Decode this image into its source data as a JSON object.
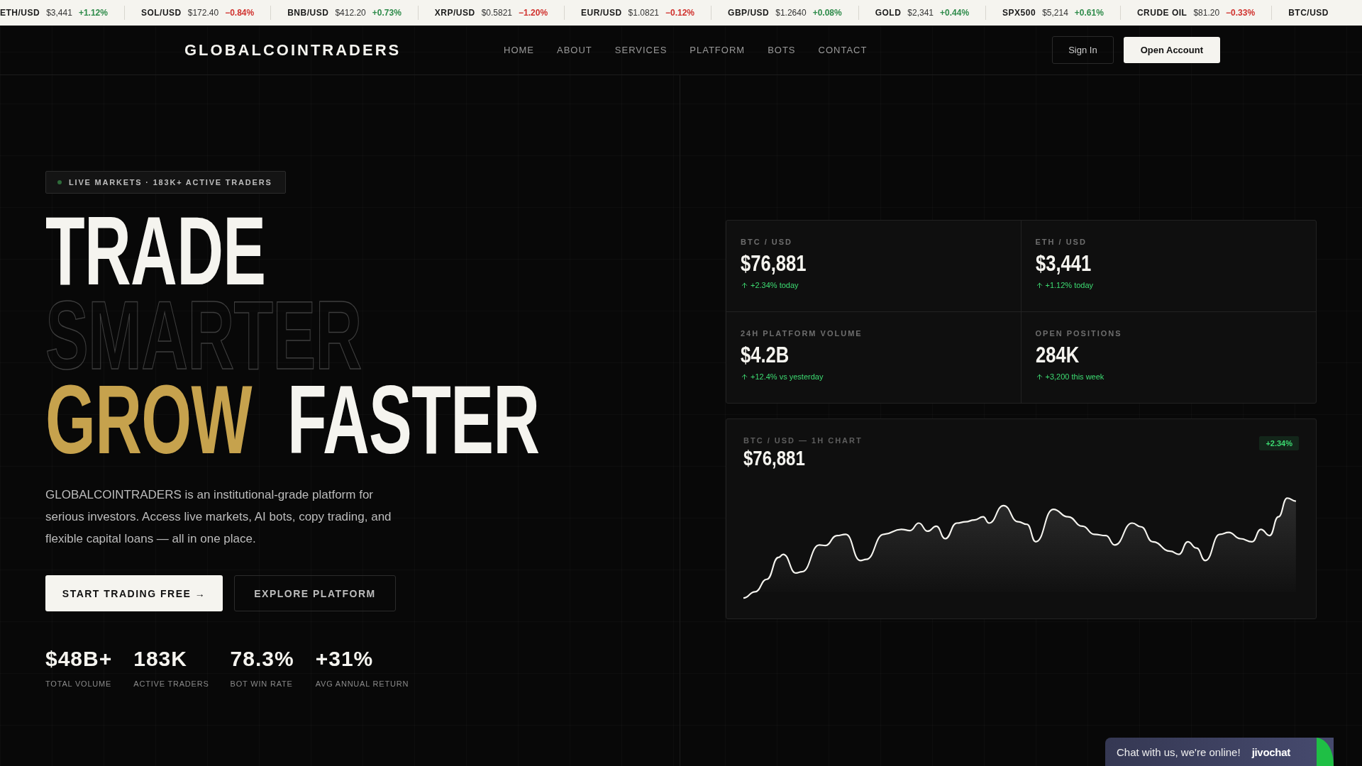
{
  "ticker": [
    {
      "symbol": "ETH/USD",
      "price": "$3,441",
      "change": "+1.12%",
      "color": "#2e8b4a"
    },
    {
      "symbol": "SOL/USD",
      "price": "$172.40",
      "change": "−0.84%",
      "color": "#d0312d"
    },
    {
      "symbol": "BNB/USD",
      "price": "$412.20",
      "change": "+0.73%",
      "color": "#2e8b4a"
    },
    {
      "symbol": "XRP/USD",
      "price": "$0.5821",
      "change": "−1.20%",
      "color": "#d0312d"
    },
    {
      "symbol": "EUR/USD",
      "price": "$1.0821",
      "change": "−0.12%",
      "color": "#d0312d"
    },
    {
      "symbol": "GBP/USD",
      "price": "$1.2640",
      "change": "+0.08%",
      "color": "#2e8b4a"
    },
    {
      "symbol": "GOLD",
      "price": "$2,341",
      "change": "+0.44%",
      "color": "#2e8b4a"
    },
    {
      "symbol": "SPX500",
      "price": "$5,214",
      "change": "+0.61%",
      "color": "#2e8b4a"
    },
    {
      "symbol": "CRUDE OIL",
      "price": "$81.20",
      "change": "−0.33%",
      "color": "#d0312d"
    },
    {
      "symbol": "BTC/USD"
    }
  ],
  "nav": {
    "logo": "GLOBALCOINTRADERS",
    "links": [
      {
        "label": "HOME"
      },
      {
        "label": "ABOUT"
      },
      {
        "label": "SERVICES"
      },
      {
        "label": "PLATFORM"
      },
      {
        "label": "BOTS"
      },
      {
        "label": "CONTACT"
      }
    ],
    "sign_in": "Sign In",
    "open_account": "Open Account"
  },
  "hero": {
    "badge": "LIVE MARKETS · 183K+ ACTIVE TRADERS",
    "headline": [
      {
        "words": [
          {
            "text": "TRADE",
            "kind": "solid"
          }
        ]
      },
      {
        "words": [
          {
            "text": "SMARTER",
            "kind": "outline"
          }
        ]
      },
      {
        "words": [
          {
            "text": "GROW",
            "kind": "gold"
          },
          {
            "text": "FASTER",
            "kind": "solid"
          }
        ]
      }
    ],
    "description": "GLOBALCOINTRADERS is an institutional-grade platform for serious investors. Access live markets, AI bots, copy trading, and flexible capital loans — all in one place.",
    "primary_button": "START TRADING FREE →",
    "secondary_button": "EXPLORE PLATFORM",
    "stats": [
      {
        "value": "$48B+",
        "label": "TOTAL VOLUME"
      },
      {
        "value": "183K",
        "label": "ACTIVE TRADERS"
      },
      {
        "value": "78.3%",
        "label": "BOT WIN RATE"
      },
      {
        "value": "+31%",
        "label": "AVG ANNUAL RETURN"
      }
    ]
  },
  "market_cards": [
    {
      "label": "BTC / USD",
      "value": "$76,881",
      "change": "+2.34% today"
    },
    {
      "label": "ETH / USD",
      "value": "$3,441",
      "change": "+1.12% today"
    },
    {
      "label": "24H PLATFORM VOLUME",
      "value": "$4.2B",
      "change": "+12.4% vs yesterday"
    },
    {
      "label": "OPEN POSITIONS",
      "value": "284K",
      "change": "+3,200 this week"
    }
  ],
  "chart_card": {
    "title": "BTC / USD — 1H CHART",
    "price": "$76,881",
    "change": "+2.34%"
  },
  "chat": {
    "message": "Chat with us, we're online!",
    "brand": "jivochat"
  }
}
